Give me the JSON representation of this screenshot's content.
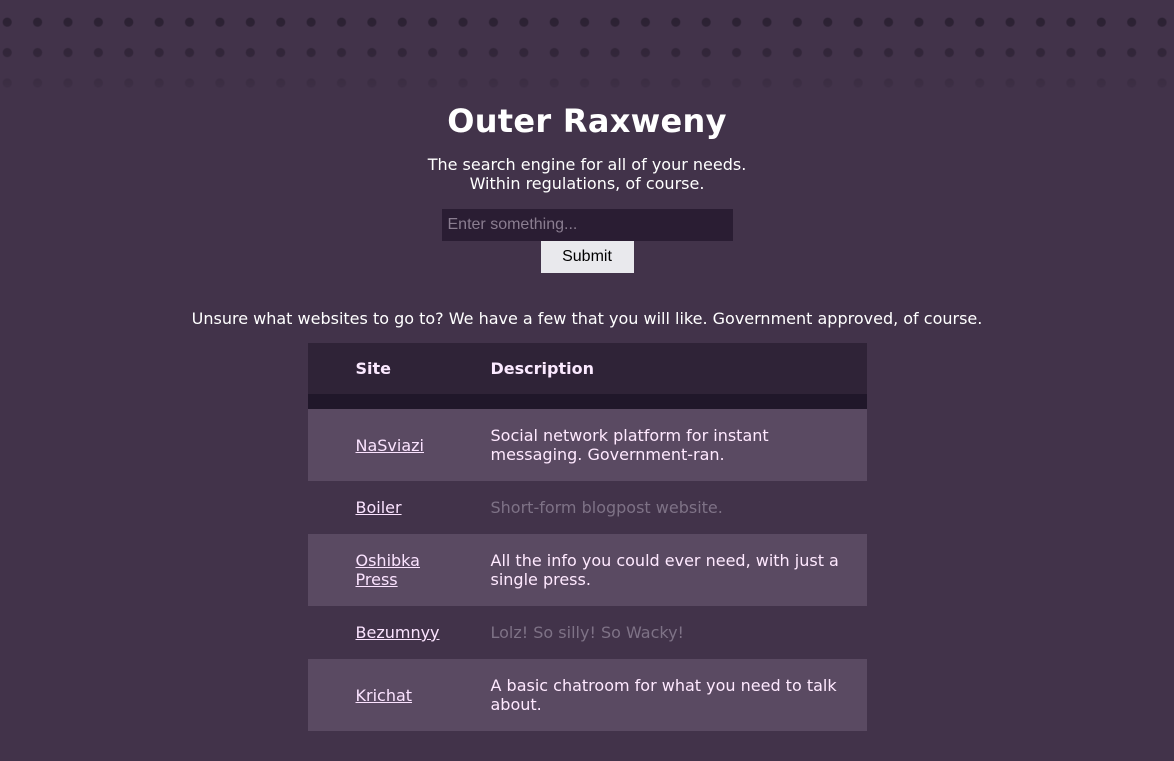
{
  "header": {
    "title": "Outer Raxweny",
    "tagline_line1": "The search engine for all of your needs.",
    "tagline_line2": "Within regulations, of course."
  },
  "search": {
    "placeholder": "Enter something...",
    "value": "",
    "submit_label": "Submit"
  },
  "intro": "Unsure what websites to go to? We have a few that you will like. Government approved, of course.",
  "table": {
    "headers": [
      "Site",
      "Description"
    ],
    "rows": [
      {
        "site": "NaSviazi",
        "description": "Social network platform for instant messaging. Government-ran."
      },
      {
        "site": "Boiler",
        "description": "Short-form blogpost website."
      },
      {
        "site": "Oshibka Press",
        "description": "All the info you could ever need, with just a single press."
      },
      {
        "site": "Bezumnyy",
        "description": "Lolz! So silly! So Wacky!"
      },
      {
        "site": "Krichat",
        "description": "A basic chatroom for what you need to talk about."
      }
    ]
  }
}
